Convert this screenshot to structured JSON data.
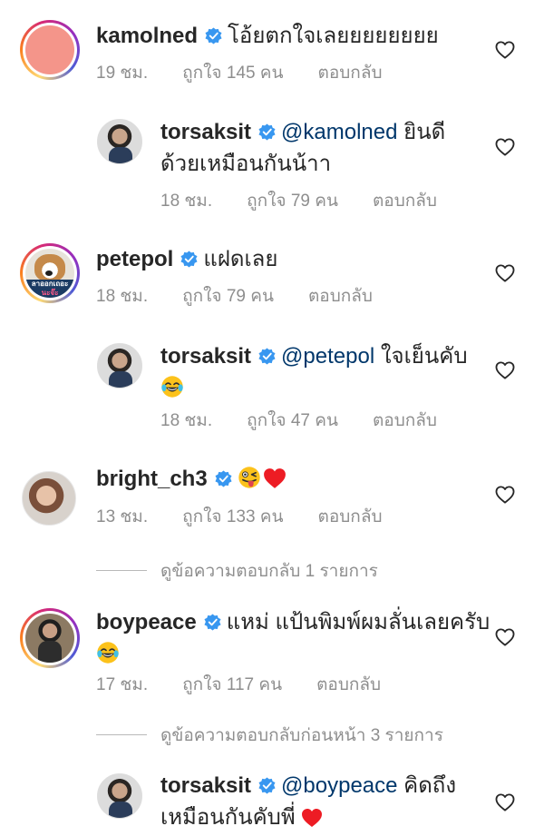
{
  "colors": {
    "verified": "#3897f0",
    "mention": "#00376b",
    "meta": "#8e8e8e",
    "heart_red": "#ed1c24"
  },
  "comments": [
    {
      "user": "kamolned",
      "text": "โอ้ยตกใจเลยยยยยยยย",
      "time": "19 ชม.",
      "likes": "ถูกใจ 145 คน",
      "reply": "ตอบกลับ"
    },
    {
      "user": "torsaksit",
      "mention": "@kamolned",
      "text_line1": " ยินดี",
      "text_line2": "ด้วยเหมือนกันน้าา",
      "time": "18 ชม.",
      "likes": "ถูกใจ 79 คน",
      "reply": "ตอบกลับ"
    },
    {
      "user": "petepol",
      "text": "แฝดเลย",
      "avatar_text": "ลาออกเถอะ",
      "avatar_text2": "นะจ๊ะ",
      "time": "18 ชม.",
      "likes": "ถูกใจ 79 คน",
      "reply": "ตอบกลับ"
    },
    {
      "user": "torsaksit",
      "mention": "@petepol",
      "text_line1": " ใจเย็นคับ",
      "time": "18 ชม.",
      "likes": "ถูกใจ 47 คน",
      "reply": "ตอบกลับ"
    },
    {
      "user": "bright_ch3",
      "time": "13 ชม.",
      "likes": "ถูกใจ 133 คน",
      "reply": "ตอบกลับ"
    },
    {
      "user": "boypeace",
      "text": "แหม่ แป้นพิมพ์ผมลั่นเลยครับ",
      "time": "17 ชม.",
      "likes": "ถูกใจ 117 คน",
      "reply": "ตอบกลับ"
    },
    {
      "user": "torsaksit",
      "mention": "@boypeace",
      "text_line1": " คิดถึง",
      "text_line2": "เหมือนกันคับพี่ "
    }
  ],
  "view_replies": [
    {
      "label": "ดูข้อความตอบกลับ 1 รายการ"
    },
    {
      "label": "ดูข้อความตอบกลับก่อนหน้า 3 รายการ"
    }
  ]
}
